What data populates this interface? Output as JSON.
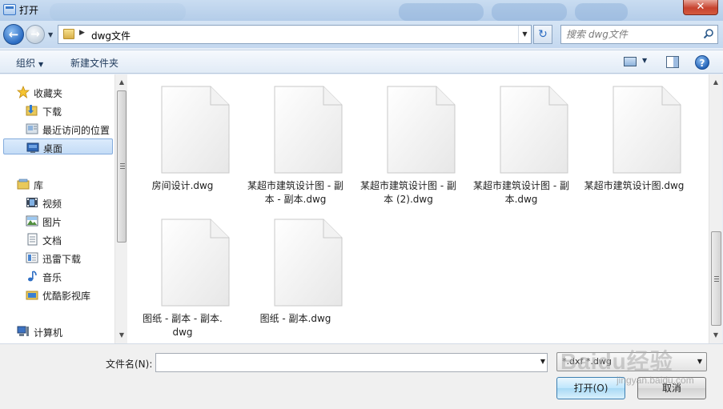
{
  "window": {
    "title": "打开",
    "close_label": "✕"
  },
  "address": {
    "path": "dwg文件"
  },
  "search": {
    "placeholder": "搜索 dwg文件"
  },
  "toolbar": {
    "organize_label": "组织",
    "new_folder_label": "新建文件夹",
    "help_label": "?"
  },
  "sidebar": {
    "items": [
      {
        "label": "收藏夹",
        "icon": "star-icon",
        "group": true
      },
      {
        "label": "下载",
        "icon": "download-folder-icon"
      },
      {
        "label": "最近访问的位置",
        "icon": "recent-places-icon"
      },
      {
        "label": "桌面",
        "icon": "desktop-icon",
        "selected": true
      },
      {
        "label": "库",
        "icon": "library-icon",
        "group": true
      },
      {
        "label": "视频",
        "icon": "video-icon"
      },
      {
        "label": "图片",
        "icon": "pictures-icon"
      },
      {
        "label": "文档",
        "icon": "documents-icon"
      },
      {
        "label": "迅雷下载",
        "icon": "thunder-download-icon"
      },
      {
        "label": "音乐",
        "icon": "music-icon"
      },
      {
        "label": "优酷影视库",
        "icon": "youku-library-icon"
      },
      {
        "label": "计算机",
        "icon": "computer-icon",
        "group": true
      }
    ]
  },
  "files": [
    {
      "name_lines": [
        "房间设计.dwg",
        ""
      ]
    },
    {
      "name_lines": [
        "某超市建筑设计图 - 副",
        "本 - 副本.dwg"
      ]
    },
    {
      "name_lines": [
        "某超市建筑设计图 - 副",
        "本 (2).dwg"
      ]
    },
    {
      "name_lines": [
        "某超市建筑设计图 - 副",
        "本.dwg"
      ]
    },
    {
      "name_lines": [
        "某超市建筑设计图.dwg",
        ""
      ]
    },
    {
      "name_lines": [
        "图纸 - 副本 - 副本.",
        "dwg"
      ]
    },
    {
      "name_lines": [
        "图纸 - 副本.dwg",
        ""
      ]
    }
  ],
  "footer": {
    "filename_label": "文件名(N):",
    "filename_value": "",
    "filetype_value": "*.dxf *.dwg",
    "open_label": "打开(O)",
    "cancel_label": "取消"
  },
  "watermark": {
    "main": "Baidu经验",
    "sub": "jingyan.baidu.com"
  }
}
